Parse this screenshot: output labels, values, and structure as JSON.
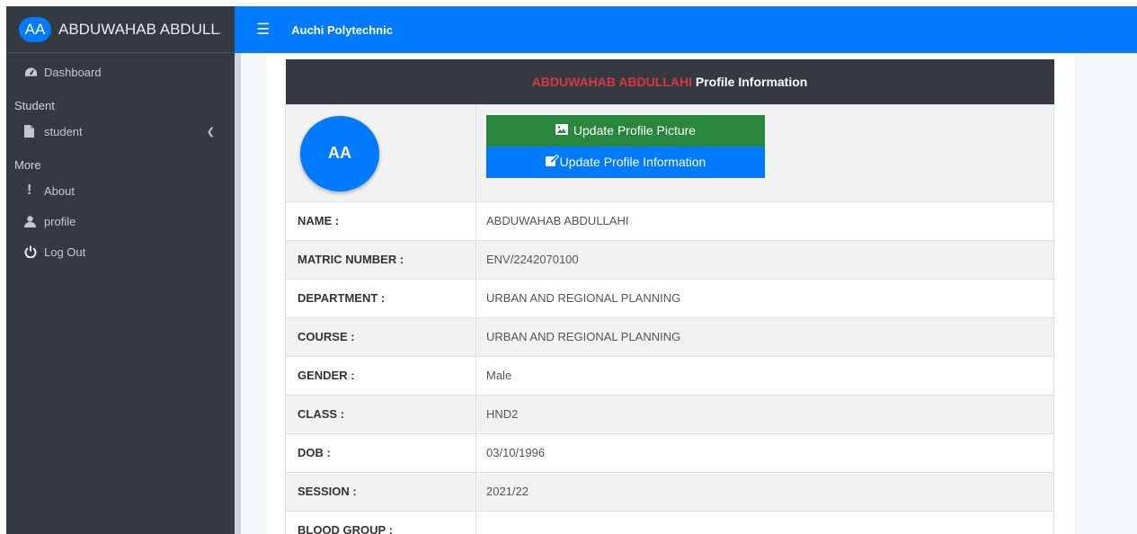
{
  "sidebar": {
    "brand_initials": "AA",
    "brand_name": "ABDUWAHAB ABDULLAHI",
    "dashboard": "Dashboard",
    "section_student": "Student",
    "student": "student",
    "section_more": "More",
    "about": "About",
    "profile": "profile",
    "logout": "Log Out"
  },
  "topbar": {
    "title": "Auchi Polytechnic"
  },
  "profile": {
    "header_name": "ABDUWAHAB ABDULLAHI",
    "header_suffix": " Profile Information",
    "avatar_initials": "AA",
    "update_picture_label": "Update Profile Picture",
    "update_info_label": "Update Profile Information",
    "rows": [
      {
        "label": "NAME :",
        "value": "ABDUWAHAB ABDULLAHI"
      },
      {
        "label": "MATRIC NUMBER :",
        "value": "ENV/2242070100"
      },
      {
        "label": "DEPARTMENT :",
        "value": "URBAN AND REGIONAL PLANNING"
      },
      {
        "label": "COURSE :",
        "value": "URBAN AND REGIONAL PLANNING"
      },
      {
        "label": "GENDER :",
        "value": "Male"
      },
      {
        "label": "CLASS :",
        "value": "HND2"
      },
      {
        "label": "DOB :",
        "value": "03/10/1996"
      },
      {
        "label": "SESSION :",
        "value": "2021/22"
      },
      {
        "label": "BLOOD GROUP :",
        "value": ""
      }
    ]
  },
  "colors": {
    "primary": "#007bff",
    "sidebar_bg": "#343a40",
    "success": "#28873d",
    "danger": "#dc3545"
  }
}
